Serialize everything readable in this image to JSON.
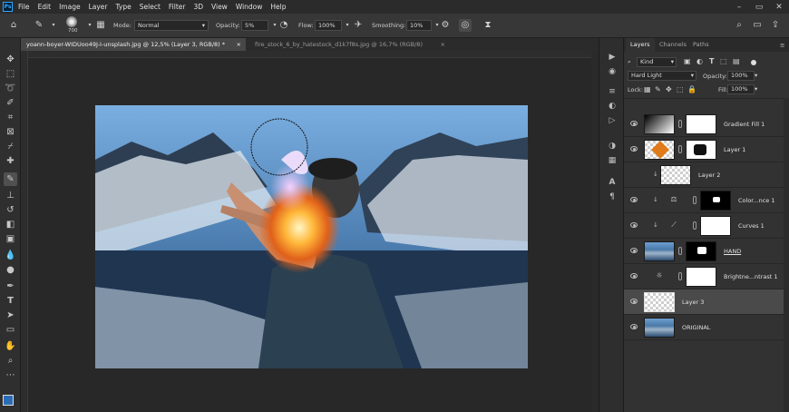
{
  "menu": [
    "File",
    "Edit",
    "Image",
    "Layer",
    "Type",
    "Select",
    "Filter",
    "3D",
    "View",
    "Window",
    "Help"
  ],
  "options": {
    "brush_size": "700",
    "mode_label": "Mode:",
    "mode_value": "Normal",
    "opacity_label": "Opacity:",
    "opacity_value": "5%",
    "flow_label": "Flow:",
    "flow_value": "100%",
    "smoothing_label": "Smoothing:",
    "smoothing_value": "10%"
  },
  "doc_tabs": [
    {
      "label": "yoann-boyer-WIDUoo49J-I-unsplash.jpg @ 12,5% (Layer 3, RGB/8) *",
      "active": true
    },
    {
      "label": "fire_stock_6_by_hatestock_d1k7f8s.jpg @ 16,7% (RGB/8)",
      "active": false
    }
  ],
  "panel": {
    "tabs": [
      "Layers",
      "Channels",
      "Paths"
    ],
    "kind_value": "Kind",
    "blend_value": "Hard Light",
    "opacity_label": "Opacity:",
    "opacity_value": "100%",
    "lock_label": "Lock:",
    "fill_label": "Fill:",
    "fill_value": "100%",
    "layers": [
      {
        "name": "Gradient Fill 1"
      },
      {
        "name": "Layer 1"
      },
      {
        "name": "Layer 2"
      },
      {
        "name": "Color...nce 1"
      },
      {
        "name": "Curves 1"
      },
      {
        "name": "HAND"
      },
      {
        "name": "Brightne...ntrast 1"
      },
      {
        "name": "Layer 3",
        "selected": true
      },
      {
        "name": "ORIGINAL"
      }
    ]
  },
  "colors": {
    "foreground": "#2b6cb5",
    "background": "#f0c030",
    "accent": "#31a8ff"
  }
}
